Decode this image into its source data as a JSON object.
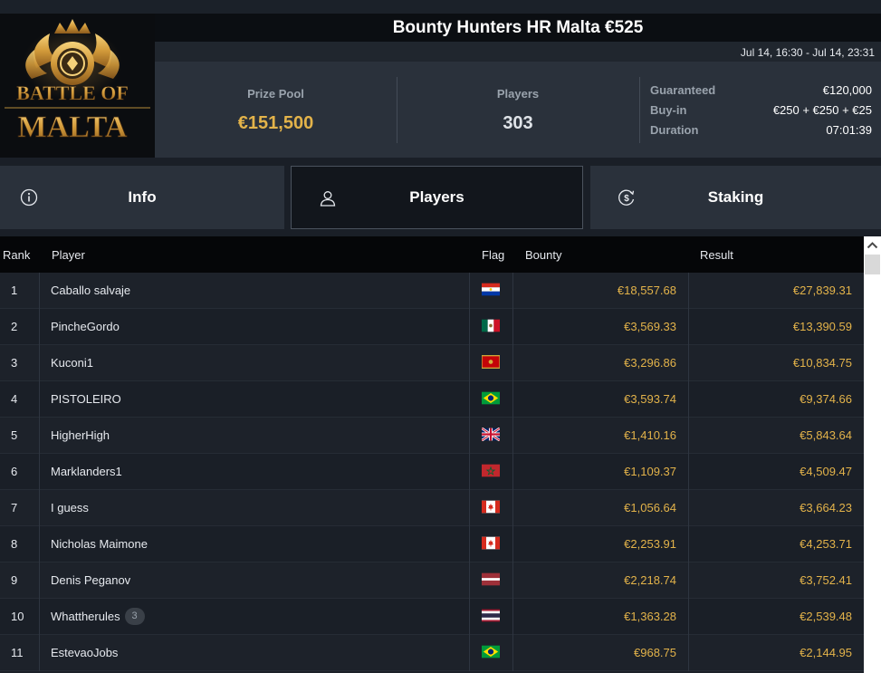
{
  "logo": {
    "line1": "BATTLE OF",
    "line2": "MALTA"
  },
  "tournament": {
    "title": "Bounty Hunters HR Malta €525",
    "dates": "Jul 14, 16:30 - Jul 14, 23:31"
  },
  "stats": {
    "prize_pool_label": "Prize Pool",
    "prize_pool_value": "€151,500",
    "players_label": "Players",
    "players_value": "303",
    "guaranteed_label": "Guaranteed",
    "guaranteed_value": "€120,000",
    "buyin_label": "Buy-in",
    "buyin_value": "€250 + €250 + €25",
    "duration_label": "Duration",
    "duration_value": "07:01:39"
  },
  "tabs": [
    {
      "label": "Info",
      "icon": "info-icon"
    },
    {
      "label": "Players",
      "icon": "user-icon",
      "active": true
    },
    {
      "label": "Staking",
      "icon": "dollar-cycle-icon"
    }
  ],
  "table": {
    "headers": {
      "rank": "Rank",
      "player": "Player",
      "flag": "Flag",
      "bounty": "Bounty",
      "result": "Result"
    },
    "rows": [
      {
        "rank": "1",
        "player": "Caballo salvaje",
        "flag": "paraguay",
        "bounty": "€18,557.68",
        "result": "€27,839.31"
      },
      {
        "rank": "2",
        "player": "PincheGordo",
        "flag": "mexico",
        "bounty": "€3,569.33",
        "result": "€13,390.59"
      },
      {
        "rank": "3",
        "player": "Kuconi1",
        "flag": "montenegro",
        "bounty": "€3,296.86",
        "result": "€10,834.75"
      },
      {
        "rank": "4",
        "player": "PISTOLEIRO",
        "flag": "brazil",
        "bounty": "€3,593.74",
        "result": "€9,374.66"
      },
      {
        "rank": "5",
        "player": "HigherHigh",
        "flag": "uk",
        "bounty": "€1,410.16",
        "result": "€5,843.64"
      },
      {
        "rank": "6",
        "player": "Marklanders1",
        "flag": "morocco",
        "bounty": "€1,109.37",
        "result": "€4,509.47"
      },
      {
        "rank": "7",
        "player": "I guess",
        "flag": "canada",
        "bounty": "€1,056.64",
        "result": "€3,664.23"
      },
      {
        "rank": "8",
        "player": "Nicholas Maimone",
        "flag": "canada",
        "bounty": "€2,253.91",
        "result": "€4,253.71"
      },
      {
        "rank": "9",
        "player": "Denis Peganov",
        "flag": "latvia",
        "bounty": "€2,218.74",
        "result": "€3,752.41"
      },
      {
        "rank": "10",
        "player": "Whattherules",
        "badge": "3",
        "flag": "thailand",
        "bounty": "€1,363.28",
        "result": "€2,539.48"
      },
      {
        "rank": "11",
        "player": "EstevaoJobs",
        "flag": "brazil",
        "bounty": "€968.75",
        "result": "€2,144.95"
      }
    ]
  },
  "colors": {
    "accent_gold": "#e3b34a",
    "panel": "#2a313b",
    "header_black": "#050608"
  }
}
